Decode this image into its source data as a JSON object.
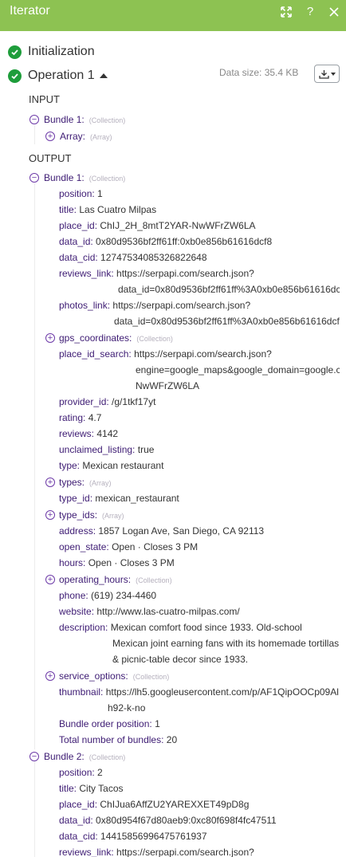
{
  "window": {
    "title": "Iterator",
    "icons": [
      "expand-icon",
      "help-icon",
      "close-icon"
    ]
  },
  "initialization": {
    "label": "Initialization"
  },
  "operation": {
    "label": "Operation 1",
    "data_size": "Data size: 35.4 KB"
  },
  "colors": {
    "accent": "#8dc252",
    "success": "#1e9d3b",
    "key": "#3d1b73",
    "toggle": "#6d3aa8"
  },
  "input": {
    "title": "INPUT",
    "bundle_label": "Bundle 1:",
    "bundle_type": "(Collection)",
    "array_label": "Array:",
    "array_type": "(Array)"
  },
  "output": {
    "title": "OUTPUT",
    "bundle1": {
      "label": "Bundle 1:",
      "type": "(Collection)",
      "fields": {
        "position": {
          "key": "position:",
          "value": "1"
        },
        "title": {
          "key": "title:",
          "value": "Las Cuatro Milpas"
        },
        "place_id": {
          "key": "place_id:",
          "value": "ChIJ_2H_8mtT2YAR-NwWFrZW6LA"
        },
        "data_id": {
          "key": "data_id:",
          "value": "0x80d9536bf2ff61ff:0xb0e856b61616dcf8"
        },
        "data_cid": {
          "key": "data_cid:",
          "value": "12747534085326822648"
        },
        "reviews_link": {
          "key": "reviews_link:",
          "value": "https://serpapi.com/search.json?",
          "value2": "data_id=0x80d9536bf2ff61ff%3A0xb0e856b61616dc"
        },
        "photos_link": {
          "key": "photos_link:",
          "value": "https://serpapi.com/search.json?",
          "value2": "data_id=0x80d9536bf2ff61ff%3A0xb0e856b61616dcf"
        },
        "gps_coordinates": {
          "key": "gps_coordinates:",
          "type": "(Collection)"
        },
        "place_id_search": {
          "key": "place_id_search:",
          "value": "https://serpapi.com/search.json?",
          "value2": "engine=google_maps&google_domain=google.c",
          "value3": "NwWFrZW6LA"
        },
        "provider_id": {
          "key": "provider_id:",
          "value": "/g/1tkf17yt"
        },
        "rating": {
          "key": "rating:",
          "value": "4.7"
        },
        "reviews": {
          "key": "reviews:",
          "value": "4142"
        },
        "unclaimed_listing": {
          "key": "unclaimed_listing:",
          "value": "true"
        },
        "type": {
          "key": "type:",
          "value": "Mexican restaurant"
        },
        "types": {
          "key": "types:",
          "type": "(Array)"
        },
        "type_id": {
          "key": "type_id:",
          "value": "mexican_restaurant"
        },
        "type_ids": {
          "key": "type_ids:",
          "type": "(Array)"
        },
        "address": {
          "key": "address:",
          "value": "1857 Logan Ave, San Diego, CA 92113"
        },
        "open_state": {
          "key": "open_state:",
          "value": "Open · Closes 3 PM"
        },
        "hours": {
          "key": "hours:",
          "value": "Open · Closes 3 PM"
        },
        "operating_hours": {
          "key": "operating_hours:",
          "type": "(Collection)"
        },
        "phone": {
          "key": "phone:",
          "value": "(619) 234-4460"
        },
        "website": {
          "key": "website:",
          "value": "http://www.las-cuatro-milpas.com/"
        },
        "description": {
          "key": "description:",
          "value": "Mexican comfort food since 1933. Old-school",
          "value2": "Mexican joint earning fans with its homemade tortillas",
          "value3": "& picnic-table decor since 1933."
        },
        "service_options": {
          "key": "service_options:",
          "type": "(Collection)"
        },
        "thumbnail": {
          "key": "thumbnail:",
          "value": "https://lh5.googleusercontent.com/p/AF1QipOOCp09Al",
          "value2": "h92-k-no"
        },
        "bundle_order_position": {
          "key": "Bundle order position:",
          "value": "1"
        },
        "total_number_of_bundles": {
          "key": "Total number of bundles:",
          "value": "20"
        }
      }
    },
    "bundle2": {
      "label": "Bundle 2:",
      "type": "(Collection)",
      "fields": {
        "position": {
          "key": "position:",
          "value": "2"
        },
        "title": {
          "key": "title:",
          "value": "City Tacos"
        },
        "place_id": {
          "key": "place_id:",
          "value": "ChIJua6AffZU2YAREXXET49pD8g"
        },
        "data_id": {
          "key": "data_id:",
          "value": "0x80d954f67d80aeb9:0xc80f698f4fc47511"
        },
        "data_cid": {
          "key": "data_cid:",
          "value": "14415856996475761937"
        },
        "reviews_link": {
          "key": "reviews_link:",
          "value": "https://serpapi.com/search.json?"
        }
      }
    }
  }
}
